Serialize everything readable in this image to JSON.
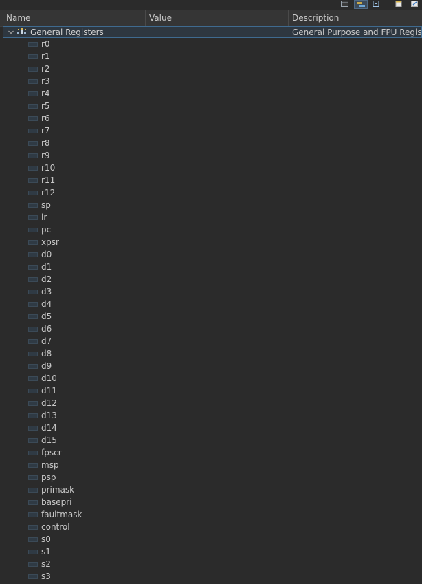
{
  "header": {
    "name_label": "Name",
    "value_label": "Value",
    "description_label": "Description"
  },
  "toolbar": {
    "icons": [
      "layout-icon",
      "show-columns-icon",
      "collapse-icon",
      "copy-icon",
      "export-icon"
    ]
  },
  "group": {
    "name": "General Registers",
    "description": "General Purpose and FPU Register G",
    "expanded": true
  },
  "registers": [
    "r0",
    "r1",
    "r2",
    "r3",
    "r4",
    "r5",
    "r6",
    "r7",
    "r8",
    "r9",
    "r10",
    "r11",
    "r12",
    "sp",
    "lr",
    "pc",
    "xpsr",
    "d0",
    "d1",
    "d2",
    "d3",
    "d4",
    "d5",
    "d6",
    "d7",
    "d8",
    "d9",
    "d10",
    "d11",
    "d12",
    "d13",
    "d14",
    "d15",
    "fpscr",
    "msp",
    "psp",
    "primask",
    "basepri",
    "faultmask",
    "control",
    "s0",
    "s1",
    "s2",
    "s3"
  ],
  "colors": {
    "background": "#2b2b2b",
    "header": "#353535",
    "selection_border": "#3f6a8f",
    "text": "#c8c8c8"
  }
}
